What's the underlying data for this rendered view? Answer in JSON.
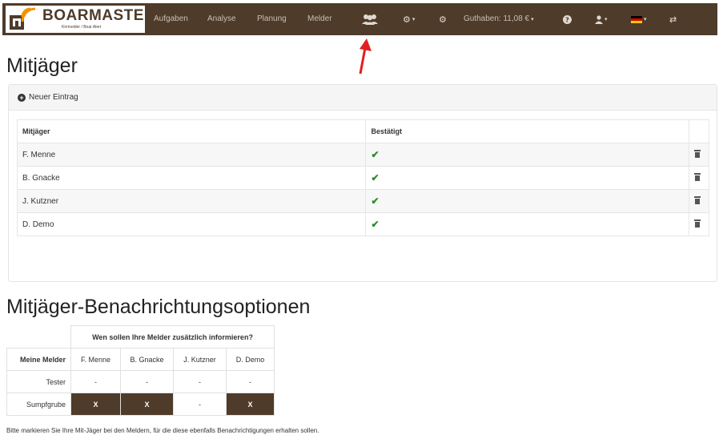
{
  "navbar": {
    "brand_name": "BOARMASTER",
    "brand_sub": "Kirrmelder / Boar Alert",
    "items": [
      "Aufgaben",
      "Analyse",
      "Planung",
      "Melder"
    ],
    "balance": "Guthaben: 11,08 €",
    "icons": [
      "users-icon",
      "gear-icon",
      "cog-icon",
      "help-icon",
      "user-icon",
      "flag-de-icon",
      "swap-icon"
    ]
  },
  "page": {
    "title": "Mitjäger",
    "new_entry": "Neuer Eintrag"
  },
  "members_table": {
    "headers": [
      "Mitjäger",
      "Bestätigt"
    ],
    "rows": [
      {
        "name": "F. Menne",
        "confirmed": "✔"
      },
      {
        "name": "B. Gnacke",
        "confirmed": "✔"
      },
      {
        "name": "J. Kutzner",
        "confirmed": "✔"
      },
      {
        "name": "D. Demo",
        "confirmed": "✔"
      }
    ]
  },
  "notify": {
    "title": "Mitjäger-Benachrichtungsoptionen",
    "question": "Wen sollen Ihre Melder zusätzlich informieren?",
    "row_header": "Meine Melder",
    "columns": [
      "F. Menne",
      "B. Gnacke",
      "J. Kutzner",
      "D. Demo"
    ],
    "rows": [
      {
        "label": "Tester",
        "cells": [
          "-",
          "-",
          "-",
          "-"
        ]
      },
      {
        "label": "Sumpfgrube",
        "cells": [
          "X",
          "X",
          "-",
          "X"
        ]
      }
    ],
    "footnote": "Bitte markieren Sie Ihre Mit-Jäger bei den Meldern, für die diese ebenfalls Benachrichtigungen erhalten sollen."
  },
  "colors": {
    "navbar": "#4e3b2a",
    "accent_orange": "#f39200",
    "check_green": "#2e8b2e",
    "arrow_red": "#e02020"
  }
}
